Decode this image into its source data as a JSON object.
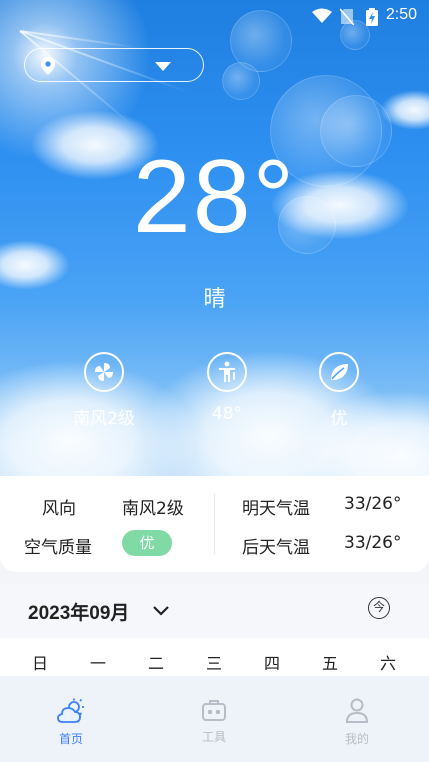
{
  "status_bar": {
    "time": "2:50",
    "icons": [
      "wifi-icon",
      "no-sim-icon",
      "battery-charging-icon"
    ]
  },
  "location": {
    "value": "",
    "icons": [
      "location-pin-icon",
      "dropdown-caret-icon"
    ]
  },
  "weather": {
    "temperature": "28°",
    "condition": "晴"
  },
  "metrics": [
    {
      "icon": "pinwheel-icon",
      "label": "南风2级"
    },
    {
      "icon": "feels-like-person-icon",
      "label": "48°"
    },
    {
      "icon": "leaf-icon",
      "label": "优"
    }
  ],
  "details": {
    "wind_dir_label": "风向",
    "wind_dir_value": "南风2级",
    "aqi_label": "空气质量",
    "aqi_value": "优",
    "tomorrow_label": "明天气温",
    "tomorrow_value": "33/26°",
    "day_after_label": "后天气温",
    "day_after_value": "33/26°"
  },
  "calendar": {
    "title": "2023年09月",
    "today_button": "今",
    "weekdays": [
      "日",
      "一",
      "二",
      "三",
      "四",
      "五",
      "六"
    ]
  },
  "tabs": [
    {
      "label": "首页",
      "icon": "cloud-sun-icon",
      "active": true
    },
    {
      "label": "工具",
      "icon": "toolbox-icon",
      "active": false
    },
    {
      "label": "我的",
      "icon": "person-icon",
      "active": false
    }
  ],
  "colors": {
    "accent": "#3b82f6",
    "inactive": "#b7bcc6",
    "badge": "#7fdaa6"
  }
}
